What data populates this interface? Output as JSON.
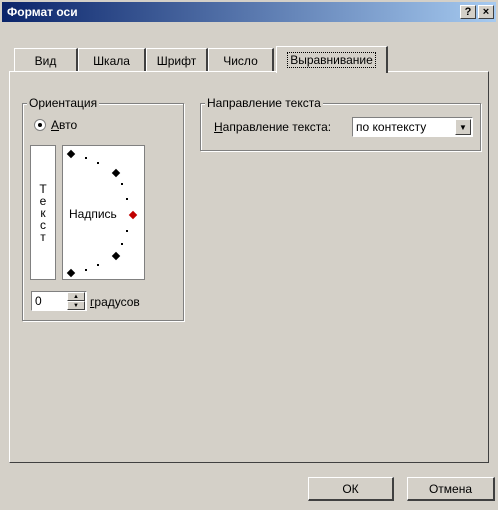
{
  "window": {
    "title": "Формат оси",
    "help_button": "?",
    "close_button": "×"
  },
  "tabs": [
    {
      "label": "Вид"
    },
    {
      "label": "Шкала"
    },
    {
      "label": "Шрифт"
    },
    {
      "label": "Число"
    },
    {
      "label": "Выравнивание",
      "active": true
    }
  ],
  "orientation": {
    "legend": "Ориентация",
    "auto_label_prefix": "",
    "auto_label_access": "А",
    "auto_label_rest": "вто",
    "vertical_text_letters": [
      "Т",
      "е",
      "к",
      "с",
      "т"
    ],
    "dial_label": "Надпись",
    "degrees_value": "0",
    "degrees_label_access": "г",
    "degrees_label_rest": "радусов"
  },
  "text_direction": {
    "legend": "Направление текста",
    "label_access": "Н",
    "label_rest": "аправление текста:",
    "select_value": "по контексту"
  },
  "buttons": {
    "ok": "ОК",
    "cancel": "Отмена"
  },
  "colors": {
    "title_bar_start": "#0a246a",
    "title_bar_end": "#a6caf0",
    "dial_marker": "#c00000"
  }
}
